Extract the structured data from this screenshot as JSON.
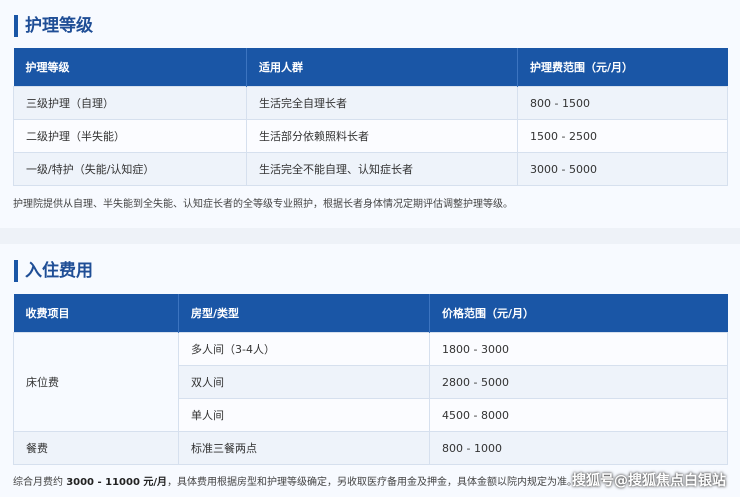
{
  "care": {
    "title": "护理等级",
    "headers": [
      "护理等级",
      "适用人群",
      "护理费范围（元/月）"
    ],
    "rows": [
      [
        "三级护理（自理）",
        "生活完全自理长者",
        "800 - 1500"
      ],
      [
        "二级护理（半失能）",
        "生活部分依赖照料长者",
        "1500 - 2500"
      ],
      [
        "一级/特护（失能/认知症）",
        "生活完全不能自理、认知症长者",
        "3000 - 5000"
      ]
    ],
    "note": "护理院提供从自理、半失能到全失能、认知症长者的全等级专业照护，根据长者身体情况定期评估调整护理等级。"
  },
  "fees": {
    "title": "入住费用",
    "headers": [
      "收费项目",
      "房型/类型",
      "价格范围（元/月）"
    ],
    "bed_label": "床位费",
    "meal_label": "餐费",
    "rows": [
      [
        "多人间（3-4人）",
        "1800 - 3000"
      ],
      [
        "双人间",
        "2800 - 5000"
      ],
      [
        "单人间",
        "4500 - 8000"
      ],
      [
        "标准三餐两点",
        "800 - 1000"
      ]
    ],
    "note_prefix": "综合月费约 ",
    "note_bold": "3000 - 11000 元/月",
    "note_suffix": "，具体费用根据房型和护理等级确定，另收取医疗备用金及押金，具体金额以院内规定为准。"
  },
  "watermark": "搜狐号@搜狐焦点白银站"
}
